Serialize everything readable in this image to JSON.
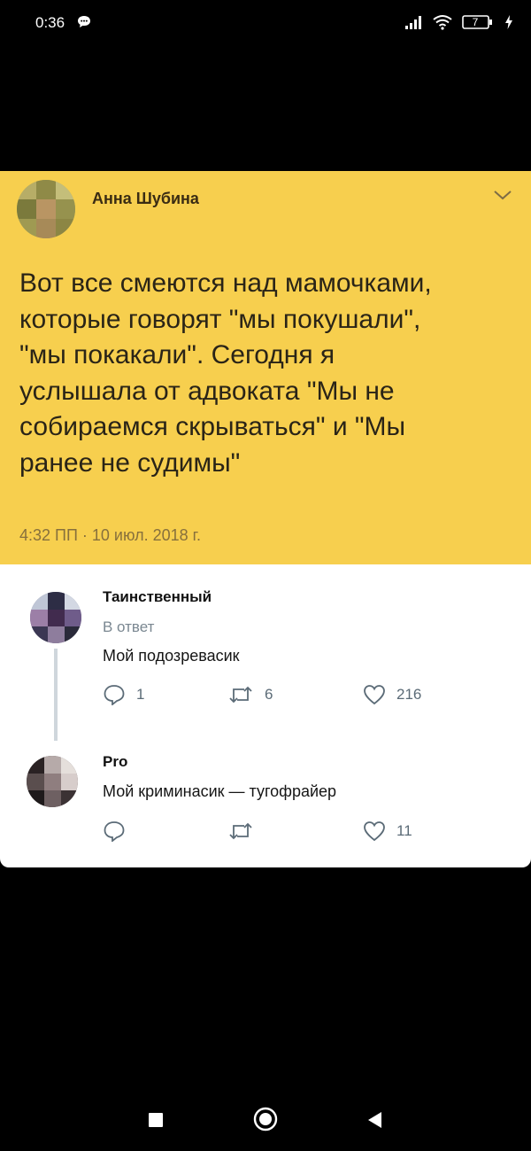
{
  "status_bar": {
    "time": "0:36",
    "battery_level": "7",
    "icons": [
      "chat-icon",
      "signal-icon",
      "wifi-icon",
      "battery-icon",
      "charging-icon"
    ]
  },
  "tweet": {
    "author_name": "Анна Шубина",
    "text_lines": [
      "Вот все смеются над мамочками,",
      "которые говорят \"мы покушали\",",
      "\"мы покакали\". Сегодня я",
      "услышала от адвоката \"Мы не",
      "собираемся скрываться\" и \"Мы",
      "ранее не судимы\""
    ],
    "timestamp": "4:32 ПП · 10 июл. 2018 г.",
    "card_color": "#f7cf4e"
  },
  "replies": [
    {
      "author_name": "Таинственный",
      "reply_to": "В ответ",
      "text": "Мой подозревасик",
      "reply_count": "1",
      "retweet_count": "6",
      "like_count": "216"
    },
    {
      "author_name": "Pro",
      "text": "Мой криминасик — тугофрайер",
      "like_count": "11"
    }
  ],
  "nav_bar": {
    "buttons": [
      "recent-apps",
      "home",
      "back"
    ]
  }
}
